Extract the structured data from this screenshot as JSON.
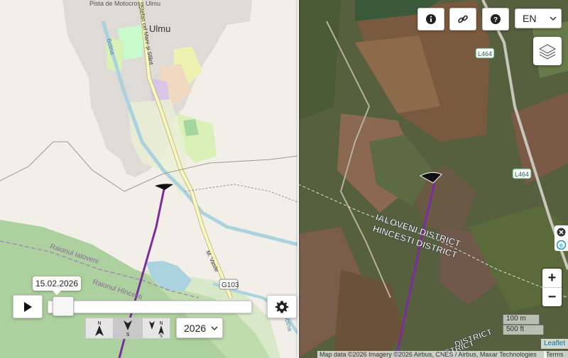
{
  "left_map": {
    "labels": {
      "town": "Ulmu",
      "motocross": "Pista de Motocross\nUlmu",
      "street1": "Ștefan cel Mare și Sfânt",
      "botna_top": "Botna",
      "botna_bottom": "Botna",
      "raion_ialoveni": "Raionul Ialoveni",
      "raion_hincesti": "Raionul Hîncești",
      "street_vasile": "M. Vasile",
      "road_badge": "G103"
    }
  },
  "right_map": {
    "labels": {
      "road_badge_top": "L464",
      "road_badge_mid": "L464",
      "district_ialoveni": "IALOVENI DISTRICT",
      "district_hincesti": "HINCEȘTI DISTRICT",
      "district_bottom": "DISTRICT",
      "district_partial": "DSTRICT"
    }
  },
  "top_controls": {
    "info_icon": "info-icon",
    "link_icon": "link-icon",
    "help_icon": "help-icon",
    "language": "EN",
    "layers_icon": "layers-icon"
  },
  "zoom": {
    "in_label": "+",
    "out_label": "−"
  },
  "scale": {
    "metric": "100 m",
    "imperial": "500 ft"
  },
  "attribution": {
    "text": "Map data ©2026 Imagery ©2026 Airbus, CNES / Airbus, Maxar Technologies",
    "terms": "Terms",
    "leaflet": "Leaflet"
  },
  "timeline": {
    "date": "15.02.2026",
    "year": "2026",
    "slider_position": 0.03,
    "direction_labels": {
      "north": "N",
      "south": "S",
      "north_south_n": "N",
      "north_south_s": "S"
    }
  },
  "colors": {
    "route_line": "#7b2d9e",
    "river": "#aad3df",
    "residential": "#dedad5",
    "forest": "#add19e",
    "road_primary": "#f7fabf"
  }
}
